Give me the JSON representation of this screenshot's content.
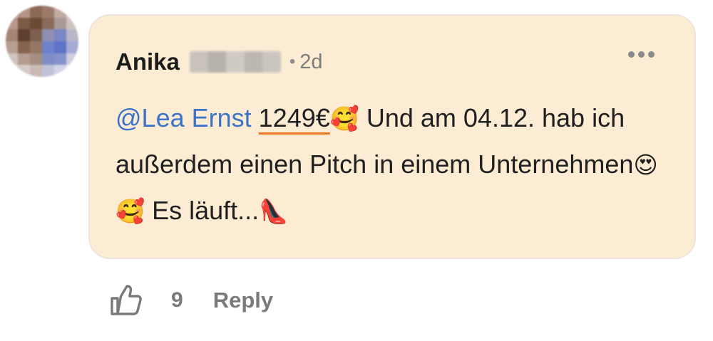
{
  "comment": {
    "author": "Anika",
    "separator": "•",
    "time": "2d",
    "mention": "@Lea Ernst",
    "price": "1249€",
    "emoji_smiling_hearts": "🥰",
    "text_part1": " Und am 04.12. hab ich außerdem einen Pitch in einem Unternehmen",
    "emoji_heart_eyes": "😍",
    "text_part2": " Es läuft...",
    "emoji_heel": "👠",
    "more_icon": "more-horizontal-icon"
  },
  "actions": {
    "like_icon": "thumbs-up-icon",
    "like_count": "9",
    "reply_label": "Reply"
  },
  "colors": {
    "bubble_bg": "#fcecd3",
    "mention": "#3b73c9",
    "price_underline": "#e9761e",
    "muted": "#7a7a7a"
  }
}
